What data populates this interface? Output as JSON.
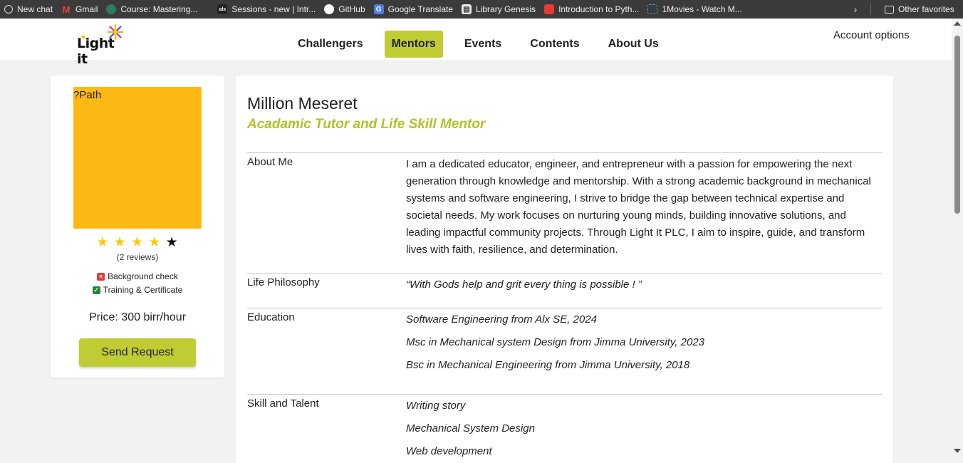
{
  "bookmarks": [
    {
      "label": "New chat",
      "icon": "openai-icon"
    },
    {
      "label": "Gmail",
      "icon": "gmail-icon"
    },
    {
      "label": "Course: Mastering...",
      "icon": "course-icon"
    },
    {
      "label": "Sessions - new | Intr...",
      "icon": "alx-icon"
    },
    {
      "label": "GitHub",
      "icon": "github-icon"
    },
    {
      "label": "Google Translate",
      "icon": "translate-icon"
    },
    {
      "label": "Library Genesis",
      "icon": "library-icon"
    },
    {
      "label": "Introduction to Pyth...",
      "icon": "python-course-icon"
    },
    {
      "label": "1Movies - Watch M...",
      "icon": "movies-icon"
    }
  ],
  "other_favorites": "Other favorites",
  "header": {
    "logo_text": "Light it",
    "nav": [
      {
        "label": "Challengers",
        "active": false
      },
      {
        "label": "Mentors",
        "active": true
      },
      {
        "label": "Events",
        "active": false
      },
      {
        "label": "Contents",
        "active": false
      },
      {
        "label": "About Us",
        "active": false
      }
    ],
    "account": "Account options",
    "accent_color": "#c0cc34"
  },
  "profile": {
    "photo_alt": "?Path",
    "rating": 4,
    "rating_max": 5,
    "reviews": "(2 reviews)",
    "background_check": "Background check",
    "background_check_ok": false,
    "training": "Training & Certificate",
    "training_ok": true,
    "price": "Price: 300 birr/hour",
    "send_request": "Send Request"
  },
  "mentor": {
    "name": "Million Meseret",
    "role": "Acadamic Tutor and Life Skill Mentor",
    "about_label": "About Me",
    "about_text": "I am a dedicated educator, engineer, and entrepreneur with a passion for empowering the next generation through knowledge and mentorship. With a strong academic background in mechanical systems and software engineering, I strive to bridge the gap between technical expertise and societal needs. My work focuses on nurturing young minds, building innovative solutions, and leading impactful community projects. Through Light It PLC, I aim to inspire, guide, and transform lives with faith, resilience, and determination.",
    "philosophy_label": "Life Philosophy",
    "philosophy_text": "“With Gods help and grit every thing is possible ! ”",
    "education_label": "Education",
    "education": [
      "Software Engineering from Alx SE, 2024",
      "Msc in Mechanical system Design from Jimma University, 2023",
      "Bsc in Mechanical Engineering from Jimma University, 2018"
    ],
    "skills_label": "Skill and Talent",
    "skills": [
      "Writing story",
      "Mechanical System Design",
      "Web development"
    ]
  }
}
